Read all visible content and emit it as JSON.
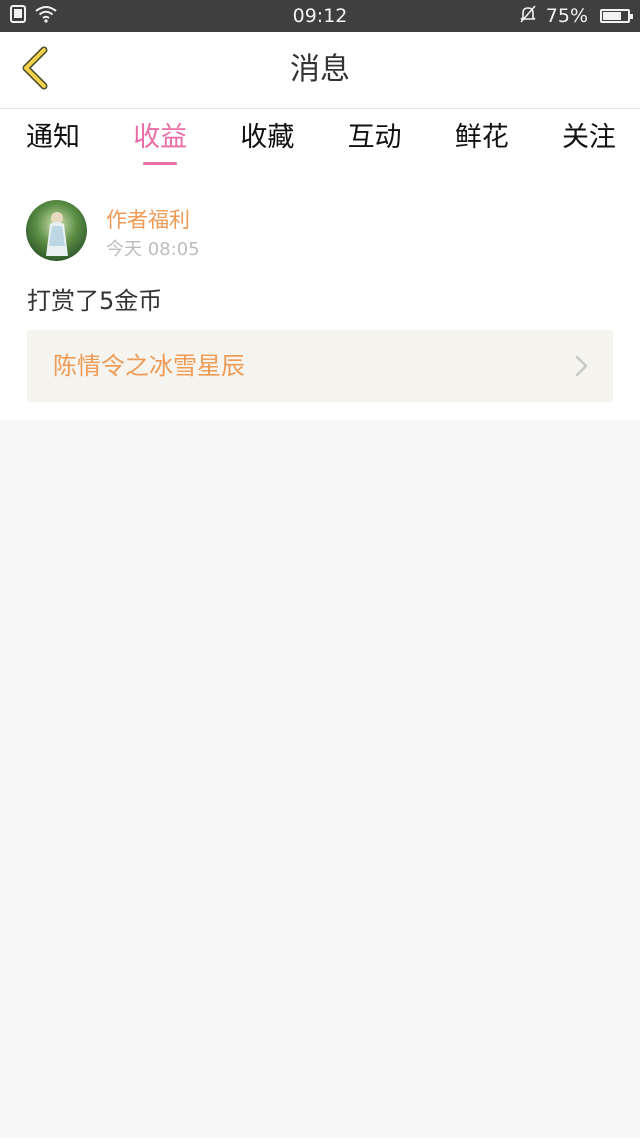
{
  "status_bar": {
    "time": "09:12",
    "battery_percent": "75%",
    "battery_level": 0.75
  },
  "header": {
    "title": "消息",
    "back_icon": "chevron-left-icon",
    "accent": "#ea6ea7"
  },
  "tabs": [
    {
      "label": "通知",
      "active": false
    },
    {
      "label": "收益",
      "active": true
    },
    {
      "label": "收藏",
      "active": false
    },
    {
      "label": "互动",
      "active": false
    },
    {
      "label": "鲜花",
      "active": false
    },
    {
      "label": "关注",
      "active": false
    }
  ],
  "message": {
    "author": "作者福利",
    "time": "今天 08:05",
    "text": "打赏了5金币",
    "book_title": "陈情令之冰雪星辰",
    "author_color": "#ef9a55"
  }
}
